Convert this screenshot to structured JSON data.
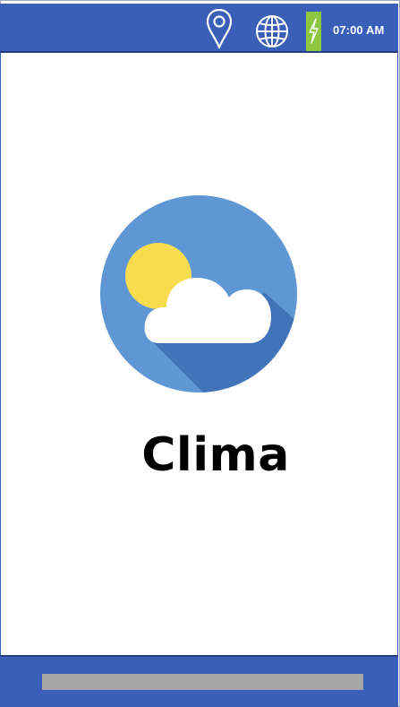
{
  "status_bar": {
    "time": "07:00 AM",
    "icons": [
      "location-pin-icon",
      "globe-icon",
      "battery-charging-icon"
    ],
    "background_color": "#3a5fb8",
    "battery_color": "#8dc63f"
  },
  "main": {
    "app_title": "Clima",
    "logo_icon": "weather-sun-cloud-icon",
    "logo_colors": {
      "circle": "#5e97d3",
      "shadow": "#4173b8",
      "sun": "#f7dc4f",
      "cloud": "#ffffff"
    }
  },
  "nav_bar": {
    "background_color": "#3a5fb8",
    "indicator_color": "#a6a6a6"
  }
}
